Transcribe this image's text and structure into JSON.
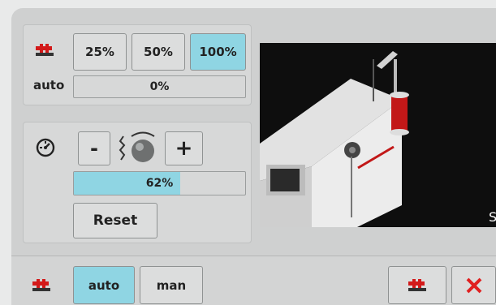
{
  "speed_section": {
    "presets": [
      {
        "label": "25%",
        "active": false
      },
      {
        "label": "50%",
        "active": false
      },
      {
        "label": "100%",
        "active": true
      }
    ],
    "auto_label": "auto",
    "auto_value_text": "0%",
    "auto_value": 0
  },
  "tension_section": {
    "minus_label": "-",
    "plus_label": "+",
    "value_text": "62%",
    "value": 62,
    "reset_label": "Reset"
  },
  "bottom_bar": {
    "auto_label": "auto",
    "man_label": "man",
    "auto_active": true
  },
  "icons": {
    "speed": "machine-speed-icon",
    "tension": "thread-tension-icon",
    "tension_dial": "tension-dial-icon",
    "bottom_left": "machine-speed-icon",
    "bottom_right": "machine-speed-icon",
    "close": "close-icon"
  },
  "colors": {
    "accent": "#8fd5e3",
    "close": "#e02020",
    "brand_red": "#d21a1a"
  },
  "preview": {
    "edge_char": "S"
  }
}
